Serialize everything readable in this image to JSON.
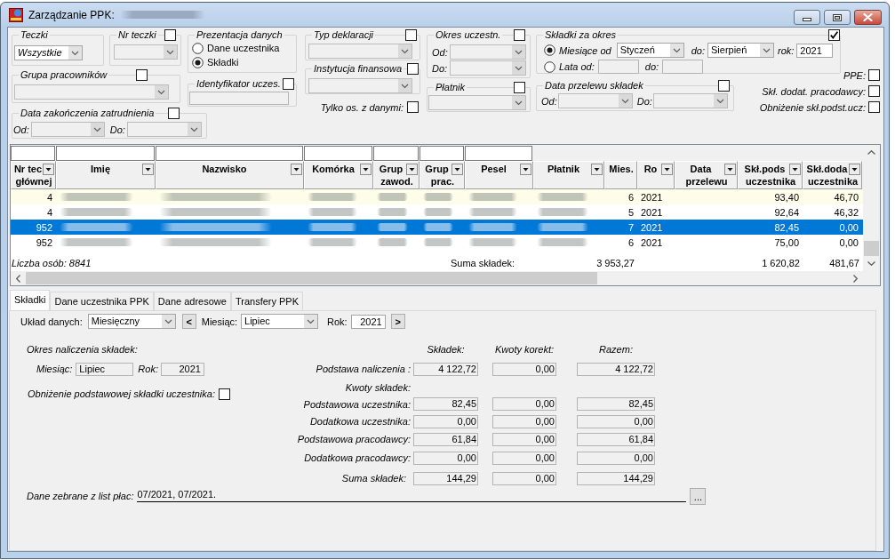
{
  "window": {
    "title": "Zarządzanie PPK:"
  },
  "filters": {
    "teczki": {
      "label": "Teczki",
      "value": "Wszystkie"
    },
    "nr_teczki": {
      "label": "Nr teczki",
      "checked": false
    },
    "prezentacja": {
      "label": "Prezentacja danych",
      "options": [
        {
          "label": "Dane uczestnika",
          "selected": false
        },
        {
          "label": "Składki",
          "selected": true
        }
      ]
    },
    "grupa_pracownikow": {
      "label": "Grupa pracowników",
      "checked": false
    },
    "identyfikator": {
      "label": "Identyfikator uczes.",
      "checked": false
    },
    "data_zakonczenia": {
      "label": "Data zakończenia zatrudnienia",
      "checked": false,
      "from_label": "Od:",
      "to_label": "Do:"
    },
    "typ_deklaracji": {
      "label": "Typ deklaracji",
      "checked": false
    },
    "instytucja_finansowa": {
      "label": "Instytucja finansowa",
      "checked": false
    },
    "tylko_z_danymi": {
      "label": "Tylko os. z danymi:",
      "checked": false
    },
    "okres_uczestn": {
      "label": "Okres uczestn.",
      "checked": false,
      "from_label": "Od:",
      "to_label": "Do:"
    },
    "platnik": {
      "label": "Płatnik",
      "checked": false
    },
    "skladki_za_okres": {
      "label": "Składki za okres",
      "checked": true,
      "months": {
        "label": "Miesiące od",
        "selected": true,
        "from_value": "Styczeń",
        "to_label": "do:",
        "to_value": "Sierpień",
        "year_label": "rok:",
        "year_value": "2021"
      },
      "years": {
        "label": "Lata od:",
        "selected": false,
        "to_label": "do:"
      }
    },
    "data_przelewu": {
      "label": "Data przelewu składek",
      "checked": false,
      "from_label": "Od:",
      "to_label": "Do:"
    },
    "flags": [
      {
        "label": "PPE:",
        "checked": false
      },
      {
        "label": "Skł. dodat. pracodawcy:",
        "checked": false
      },
      {
        "label": "Obniżenie skł.podst.ucz:",
        "checked": false
      }
    ]
  },
  "table": {
    "columns": [
      {
        "lines": [
          "Nr tec",
          "głównej"
        ],
        "kind": "number",
        "dropdown": true,
        "filter_field": true
      },
      {
        "lines": [
          "Imię"
        ],
        "kind": "redacted",
        "dropdown": true,
        "filter_field": true
      },
      {
        "lines": [
          "Nazwisko"
        ],
        "kind": "redacted",
        "dropdown": true,
        "filter_field": true
      },
      {
        "lines": [
          "Komórka"
        ],
        "kind": "redacted",
        "dropdown": true,
        "filter_field": true
      },
      {
        "lines": [
          "Grup",
          "zawod."
        ],
        "kind": "redacted",
        "dropdown": true,
        "filter_field": true
      },
      {
        "lines": [
          "Grup",
          "prac."
        ],
        "kind": "redacted",
        "dropdown": true,
        "filter_field": true
      },
      {
        "lines": [
          "Pesel"
        ],
        "kind": "redacted",
        "dropdown": true,
        "filter_field": true
      },
      {
        "lines": [
          "Płatnik"
        ],
        "kind": "redacted",
        "dropdown": true,
        "filter_field": false
      },
      {
        "lines": [
          "Mies."
        ],
        "kind": "number",
        "dropdown": false,
        "filter_field": false,
        "total": "3 953,27"
      },
      {
        "lines": [
          "Ro"
        ],
        "kind": "text",
        "dropdown": true,
        "filter_field": false
      },
      {
        "lines": [
          "Data",
          "przelewu"
        ],
        "kind": "text",
        "dropdown": true,
        "filter_field": false
      },
      {
        "lines": [
          "Skł.pods",
          "uczestnika"
        ],
        "kind": "number",
        "dropdown": true,
        "filter_field": false,
        "total": "1 620,82"
      },
      {
        "lines": [
          "Skł.doda",
          "uczestnika"
        ],
        "kind": "number",
        "dropdown": true,
        "filter_field": false,
        "total": "481,67"
      }
    ],
    "rows": [
      {
        "selected": false,
        "highlighted": true,
        "cells": [
          "4",
          null,
          null,
          null,
          null,
          null,
          null,
          null,
          "6",
          "2021",
          null,
          "93,40",
          "46,70"
        ]
      },
      {
        "selected": false,
        "highlighted": false,
        "cells": [
          "4",
          null,
          null,
          null,
          null,
          null,
          null,
          null,
          "5",
          "2021",
          null,
          "92,64",
          "46,32"
        ]
      },
      {
        "selected": true,
        "highlighted": false,
        "cells": [
          "952",
          null,
          null,
          null,
          null,
          null,
          null,
          null,
          "7",
          "2021",
          null,
          "82,45",
          "0,00"
        ]
      },
      {
        "selected": false,
        "highlighted": false,
        "cells": [
          "952",
          null,
          null,
          null,
          null,
          null,
          null,
          null,
          "6",
          "2021",
          null,
          "75,00",
          "0,00"
        ]
      }
    ],
    "count": "Liczba osób: 8841",
    "sum_label": "Suma składek:"
  },
  "tabs": [
    {
      "label": "Składki",
      "selected": true
    },
    {
      "label": "Dane uczestnika PPK",
      "selected": false
    },
    {
      "label": "Dane adresowe",
      "selected": false
    },
    {
      "label": "Transfery PPK",
      "selected": false
    }
  ],
  "panel": {
    "toolbar": {
      "layout_label": "Układ danych:",
      "layout_value": "Miesięczny",
      "prev_button": "<",
      "month_label": "Miesiąc:",
      "month_value": "Lipiec",
      "year_label": "Rok:",
      "year_value": "2021",
      "next_button": ">"
    },
    "period": {
      "title": "Okres naliczenia składek:",
      "month_label": "Miesiąc:",
      "month_value": "Lipiec",
      "year_label": "Rok:",
      "year_value": "2021"
    },
    "reduction": {
      "label": "Obniżenie podstawowej składki uczestnika:",
      "checked": false
    },
    "amounts": {
      "columns": [
        "Składek:",
        "Kwoty korekt:",
        "Razem:"
      ],
      "rows": [
        {
          "kind": "values",
          "label": "Podstawa naliczenia :",
          "values": [
            "4 122,72",
            "0,00",
            "4 122,72"
          ]
        },
        {
          "kind": "heading",
          "label": "Kwoty składek:"
        },
        {
          "kind": "values",
          "label": "Podstawowa uczestnika:",
          "values": [
            "82,45",
            "0,00",
            "82,45"
          ]
        },
        {
          "kind": "values",
          "label": "Dodatkowa uczestnika:",
          "values": [
            "0,00",
            "0,00",
            "0,00"
          ]
        },
        {
          "kind": "values",
          "label": "Podstawowa pracodawcy:",
          "values": [
            "61,84",
            "0,00",
            "61,84"
          ]
        },
        {
          "kind": "values",
          "label": "Dodatkowa pracodawcy:",
          "values": [
            "0,00",
            "0,00",
            "0,00"
          ]
        },
        {
          "kind": "total",
          "label": "Suma składek:",
          "values": [
            "144,29",
            "0,00",
            "144,29"
          ]
        }
      ]
    },
    "source": {
      "label": "Dane zebrane z list płac:",
      "value": "07/2021, 07/2021.",
      "button": "..."
    }
  }
}
